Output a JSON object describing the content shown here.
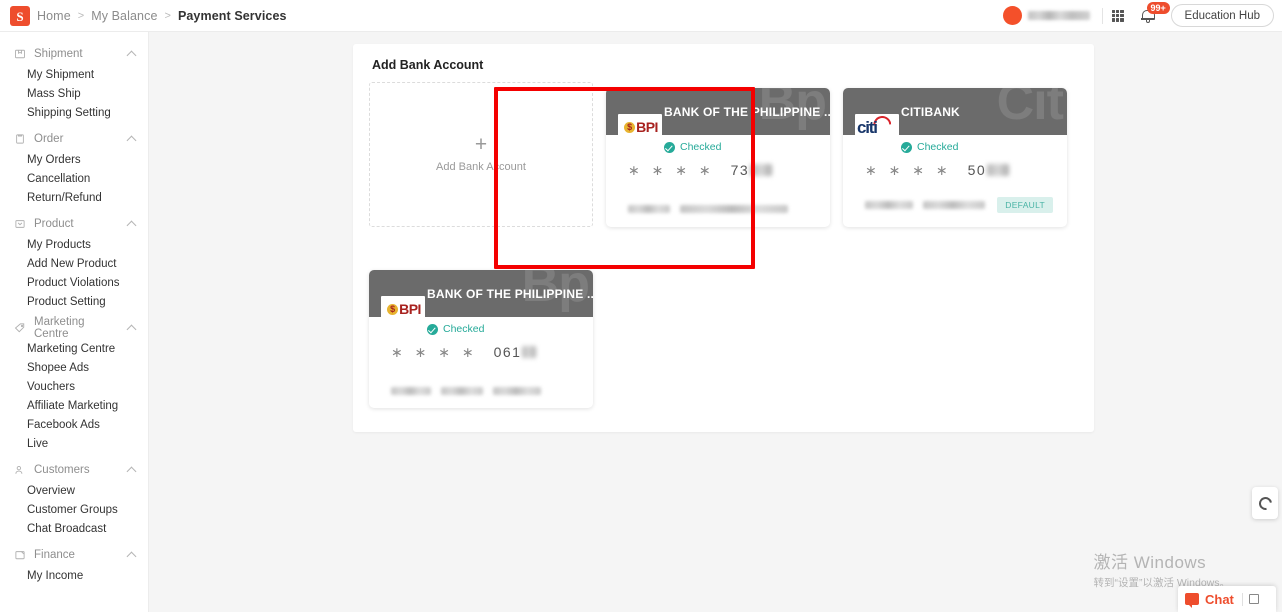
{
  "header": {
    "logo_icon": "shopee-logo",
    "breadcrumb": [
      "Home",
      "My Balance",
      "Payment Services"
    ],
    "separator": ">",
    "grid_icon": "grid-apps-icon",
    "bell_icon": "notification-bell-icon",
    "notification_count": "99+",
    "education_hub_label": "Education Hub"
  },
  "sidebar": {
    "groups": [
      {
        "title": "Shipment",
        "icon": "shipment-box-icon",
        "items": [
          "My Shipment",
          "Mass Ship",
          "Shipping Setting"
        ]
      },
      {
        "title": "Order",
        "icon": "order-clipboard-icon",
        "items": [
          "My Orders",
          "Cancellation",
          "Return/Refund"
        ]
      },
      {
        "title": "Product",
        "icon": "product-tag-icon",
        "items": [
          "My Products",
          "Add New Product",
          "Product Violations",
          "Product Setting"
        ]
      },
      {
        "title": "Marketing Centre",
        "icon": "marketing-label-icon",
        "items": [
          "Marketing Centre",
          "Shopee Ads",
          "Vouchers",
          "Affiliate Marketing",
          "Facebook Ads",
          "Live"
        ]
      },
      {
        "title": "Customers",
        "icon": "customers-people-icon",
        "items": [
          "Overview",
          "Customer Groups",
          "Chat Broadcast"
        ]
      },
      {
        "title": "Finance",
        "icon": "finance-wallet-icon",
        "items": [
          "My Income"
        ]
      }
    ]
  },
  "main": {
    "add_section_title": "Add Bank Account",
    "add_placeholder_label": "Add Bank Account",
    "plus_icon": "plus-icon",
    "cards": [
      {
        "bank_name": "BANK OF THE PHILIPPINE ...",
        "watermark": "Bp",
        "logo": "bpi-logo",
        "logo_text": "BPI",
        "status": "Checked",
        "status_icon": "check-circle-icon",
        "mask_stars": "∗ ∗ ∗ ∗",
        "account_digits": "73",
        "is_default": false,
        "default_label": ""
      },
      {
        "bank_name": "CITIBANK",
        "watermark": "Cit",
        "logo": "citi-logo",
        "logo_text": "citi",
        "status": "Checked",
        "status_icon": "check-circle-icon",
        "mask_stars": "∗ ∗ ∗ ∗",
        "account_digits": "50",
        "is_default": true,
        "default_label": "DEFAULT"
      },
      {
        "bank_name": "BANK OF THE PHILIPPINE ...",
        "watermark": "Bp",
        "logo": "bpi-logo",
        "logo_text": "BPI",
        "status": "Checked",
        "status_icon": "check-circle-icon",
        "mask_stars": "∗ ∗ ∗ ∗",
        "account_digits": "061",
        "is_default": false,
        "default_label": ""
      }
    ]
  },
  "side_widget": {
    "icon": "loading-ring-icon"
  },
  "windows_watermark": {
    "line1": "激活 Windows",
    "line2": "转到“设置”以激活 Windows。"
  },
  "chat_widget": {
    "label": "Chat",
    "icon": "chat-bubble-icon",
    "expand_icon": "expand-icon"
  },
  "colors": {
    "brand_orange": "#ee4d2d",
    "highlight_red": "#f40000",
    "status_green": "#26aa99",
    "card_header_gray": "#6b6b6b",
    "default_badge_bg": "#d9f0ec"
  }
}
